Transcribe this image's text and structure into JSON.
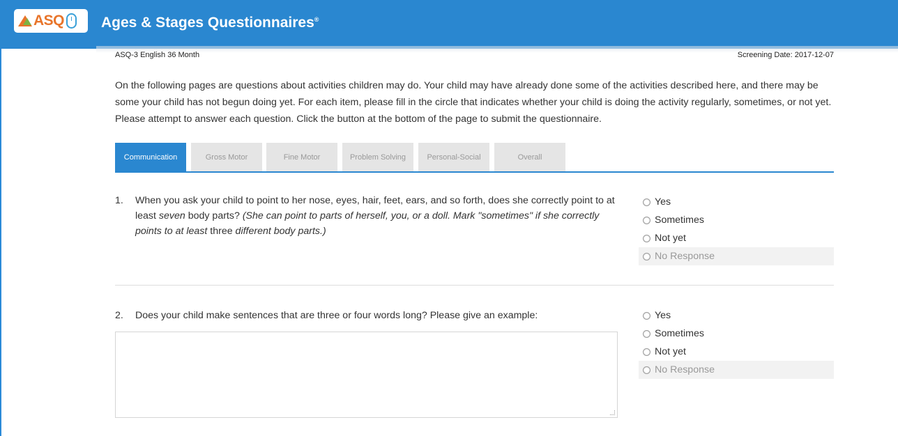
{
  "header": {
    "logo_text": "ASQ",
    "app_title": "Ages & Stages Questionnaires",
    "registered_mark": "®",
    "brand_color": "#2a87d0"
  },
  "meta": {
    "form_name": "ASQ-3 English 36 Month",
    "screening_date": "Screening Date: 2017-12-07"
  },
  "intro": "On the following pages are questions about activities children may do. Your child may have already done some of the activities described here, and there may be some your child has not begun doing yet. For each item, please fill in the circle that indicates whether your child is doing the activity regularly, sometimes, or not yet. Please attempt to answer each question. Click the button at the bottom of the page to submit the questionnaire.",
  "tabs": [
    {
      "label": "Communication",
      "active": true
    },
    {
      "label": "Gross Motor",
      "active": false
    },
    {
      "label": "Fine Motor",
      "active": false
    },
    {
      "label": "Problem Solving",
      "active": false
    },
    {
      "label": "Personal-Social",
      "active": false
    },
    {
      "label": "Overall",
      "active": false
    }
  ],
  "questions": [
    {
      "number": "1.",
      "text_a": "When you ask your child to point to her nose, eyes, hair, feet, ears, and so forth, does she correctly point to at least ",
      "text_b": "seven",
      "text_c": " body parts? ",
      "text_d": "(She can point to parts of herself, you, or a doll. Mark \"sometimes\" if she correctly points to at least ",
      "text_e": "three",
      "text_f": " different body parts.)",
      "options": [
        "Yes",
        "Sometimes",
        "Not yet",
        "No Response"
      ]
    },
    {
      "number": "2.",
      "text": "Does your child make sentences that are three or four words long? Please give an example:",
      "answer_value": "",
      "options": [
        "Yes",
        "Sometimes",
        "Not yet",
        "No Response"
      ]
    }
  ]
}
